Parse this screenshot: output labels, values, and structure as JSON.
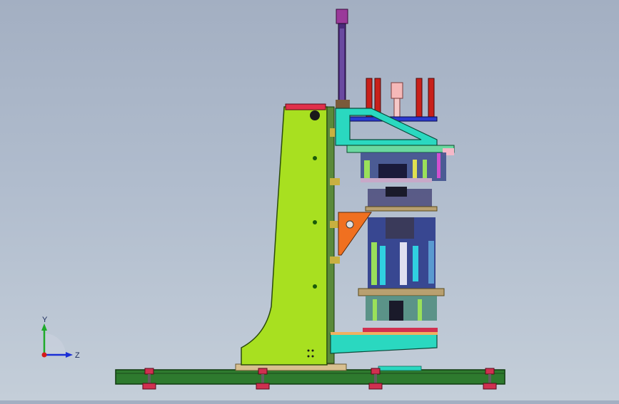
{
  "triad": {
    "y_label": "Y",
    "z_label": "Z",
    "colors": {
      "y": "#1faa2a",
      "z": "#1a2fd6",
      "x": "#d61a1a",
      "origin": "#7a8ca8"
    }
  },
  "model": {
    "colors": {
      "base_beam": "#2e7a2e",
      "column": "#a8e020",
      "cylinder": "#4a2a7a",
      "red_cylinders": "#c8201a",
      "pink_part": "#f5b8b8",
      "cyan_bracket": "#2ad8c0",
      "orange_gusset": "#f07020",
      "blue_plate": "#2a3ad0",
      "tan_plate": "#d8c090",
      "foot": "#d03050"
    }
  }
}
